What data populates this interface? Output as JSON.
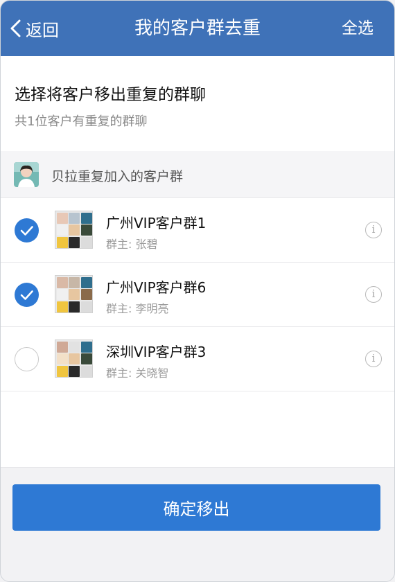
{
  "nav": {
    "back_label": "返回",
    "title": "我的客户群去重",
    "select_all": "全选"
  },
  "header": {
    "title": "选择将客户移出重复的群聊",
    "subtitle": "共1位客户有重复的群聊"
  },
  "customer": {
    "label": "贝拉重复加入的客户群"
  },
  "groups": [
    {
      "name": "广州VIP客户群1",
      "owner": "群主: 张碧",
      "selected": true
    },
    {
      "name": "广州VIP客户群6",
      "owner": "群主: 李明亮",
      "selected": true
    },
    {
      "name": "深圳VIP客户群3",
      "owner": "群主: 关晓智",
      "selected": false
    }
  ],
  "footer": {
    "confirm_label": "确定移出"
  },
  "colors": {
    "nav_bg": "#3f72b8",
    "accent": "#2e79d4",
    "muted_text": "#9a9a9a"
  },
  "icons": {
    "back": "chevron-left-icon",
    "check": "checkmark-icon",
    "info": "info-icon"
  }
}
